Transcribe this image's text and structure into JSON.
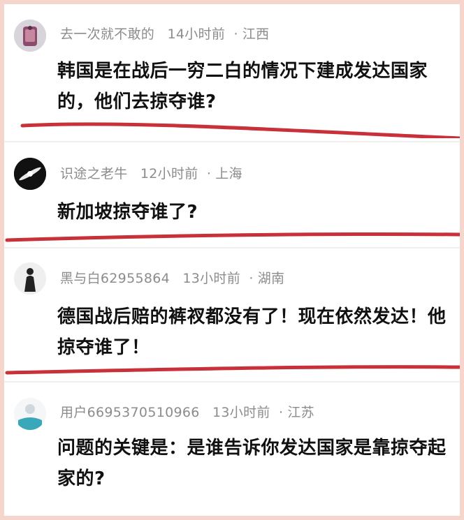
{
  "comments": [
    {
      "username": "去一次就不敢的",
      "time": "14小时前",
      "location": "江西",
      "text": "韩国是在战后一穷二白的情况下建成发达国家的，他们去掠夺谁?"
    },
    {
      "username": "识途之老牛",
      "time": "12小时前",
      "location": "上海",
      "text": "新加坡掠夺谁了?"
    },
    {
      "username": "黑与白62955864",
      "time": "13小时前",
      "location": "湖南",
      "text": "德国战后赔的裤衩都没有了！现在依然发达！他掠夺谁了！"
    },
    {
      "username": "用户6695370510966",
      "time": "13小时前",
      "location": "江苏",
      "text": "问题的关键是：是谁告诉你发达国家是靠掠夺起家的?"
    }
  ],
  "meta_separator": "·",
  "colors": {
    "underline": "#c8303a",
    "meta_text": "#8c8c8c",
    "body_text": "#111111",
    "page_border": "#f6d6cc"
  }
}
